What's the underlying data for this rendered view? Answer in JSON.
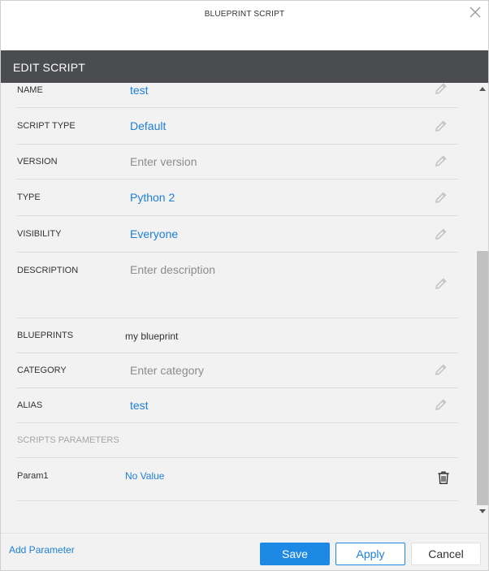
{
  "dialog": {
    "title": "BLUEPRINT SCRIPT",
    "close_icon": "close-icon"
  },
  "section": {
    "title": "EDIT SCRIPT"
  },
  "fields": {
    "name": {
      "label": "NAME",
      "value": "test"
    },
    "script_type": {
      "label": "SCRIPT TYPE",
      "value": "Default"
    },
    "version": {
      "label": "VERSION",
      "placeholder": "Enter version"
    },
    "type": {
      "label": "TYPE",
      "value": "Python 2"
    },
    "visibility": {
      "label": "VISIBILITY",
      "value": "Everyone"
    },
    "description": {
      "label": "DESCRIPTION",
      "placeholder": "Enter description"
    },
    "blueprints": {
      "label": "BLUEPRINTS",
      "value": "my blueprint"
    },
    "category": {
      "label": "CATEGORY",
      "placeholder": "Enter category"
    },
    "alias": {
      "label": "ALIAS",
      "value": "test"
    }
  },
  "parameters": {
    "heading": "SCRIPTS PARAMETERS",
    "items": [
      {
        "name": "Param1",
        "value": "No Value"
      }
    ]
  },
  "footer": {
    "add_parameter": "Add Parameter",
    "save": "Save",
    "apply": "Apply",
    "cancel": "Cancel"
  },
  "colors": {
    "header_bg": "#4a4c50",
    "link": "#1e7fd6",
    "primary": "#1e88e5"
  },
  "icons": {
    "edit": "pencil-icon",
    "delete": "trash-icon"
  }
}
